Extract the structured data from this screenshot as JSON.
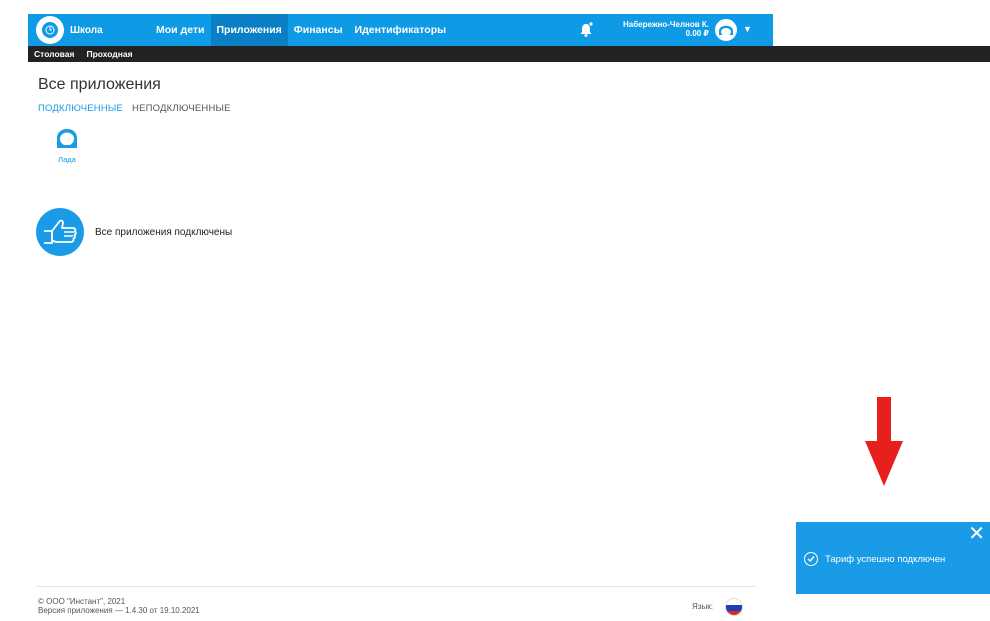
{
  "header": {
    "brand": "Школа",
    "nav": [
      {
        "label": "Мои дети"
      },
      {
        "label": "Приложения"
      },
      {
        "label": "Финансы"
      },
      {
        "label": "Идентификаторы"
      }
    ],
    "user_name": "Набережно-Челнов К.",
    "balance": "0.00 ₽"
  },
  "subnav": [
    {
      "label": "Столовая"
    },
    {
      "label": "Проходная"
    }
  ],
  "page": {
    "title": "Все приложения",
    "tabs": [
      {
        "label": "ПОДКЛЮЧЕННЫЕ"
      },
      {
        "label": "НЕПОДКЛЮЧЕННЫЕ"
      }
    ],
    "apps": [
      {
        "label": "Лада",
        "icon": "girl-avatar-icon"
      }
    ],
    "empty_message": "Все приложения подключены"
  },
  "footer": {
    "copyright": "© ООО \"Инстант\", 2021",
    "version": "Версия приложения — 1.4.30 от 19.10.2021",
    "language_label": "Язык:"
  },
  "toast": {
    "message": "Тариф успешно подключен",
    "close": "✕"
  },
  "colors": {
    "primary": "#0f9ae6",
    "primary_dark": "#0b7fc6",
    "subbar": "#222222",
    "accent_text": "#1a9be8",
    "arrow": "#e8201d"
  }
}
